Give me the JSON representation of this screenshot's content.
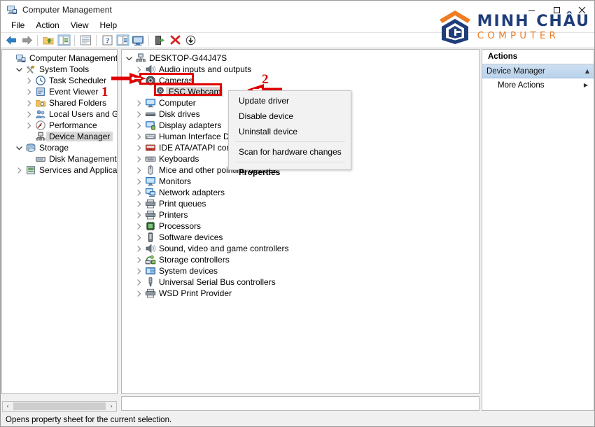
{
  "window": {
    "title": "Computer Management",
    "title_icon": "computer-management-icon",
    "minimize": "–",
    "maximize": "☐",
    "close": "✕"
  },
  "menubar": {
    "items": [
      {
        "label": "File",
        "name": "menu-file"
      },
      {
        "label": "Action",
        "name": "menu-action"
      },
      {
        "label": "View",
        "name": "menu-view"
      },
      {
        "label": "Help",
        "name": "menu-help"
      }
    ]
  },
  "toolbar": {
    "buttons": [
      {
        "icon": "back-arrow-icon",
        "title": "Back"
      },
      {
        "icon": "forward-arrow-icon",
        "title": "Forward"
      },
      {
        "icon": "up-folder-icon",
        "title": "Up One Level"
      },
      {
        "icon": "show-hide-console-tree-icon",
        "title": "Show/Hide Console Tree"
      },
      {
        "icon": "properties-icon",
        "title": "Properties"
      },
      {
        "icon": "help-icon",
        "title": "Help"
      },
      {
        "icon": "list-view-icon",
        "title": "View"
      },
      {
        "icon": "display-icon",
        "title": "Connect to another computer"
      },
      {
        "icon": "update-driver-icon",
        "title": "Update driver"
      },
      {
        "icon": "uninstall-device-icon",
        "title": "Uninstall device"
      },
      {
        "icon": "scan-hardware-icon",
        "title": "Scan for hardware changes"
      }
    ]
  },
  "console_tree": {
    "root": {
      "label": "Computer Management (Local",
      "icon": "computer-management-icon",
      "indent": 0,
      "twisty": "none",
      "selected": false
    },
    "items": [
      {
        "label": "System Tools",
        "icon": "system-tools-icon",
        "indent": 1,
        "twisty": "open",
        "selected": false
      },
      {
        "label": "Task Scheduler",
        "icon": "clock-icon",
        "indent": 2,
        "twisty": "closed",
        "selected": false
      },
      {
        "label": "Event Viewer",
        "icon": "event-viewer-icon",
        "indent": 2,
        "twisty": "closed",
        "selected": false
      },
      {
        "label": "Shared Folders",
        "icon": "shared-folders-icon",
        "indent": 2,
        "twisty": "closed",
        "selected": false
      },
      {
        "label": "Local Users and Groups",
        "icon": "users-icon",
        "indent": 2,
        "twisty": "closed",
        "selected": false
      },
      {
        "label": "Performance",
        "icon": "performance-icon",
        "indent": 2,
        "twisty": "closed",
        "selected": false
      },
      {
        "label": "Device Manager",
        "icon": "device-manager-icon",
        "indent": 2,
        "twisty": "none",
        "selected": true
      },
      {
        "label": "Storage",
        "icon": "storage-icon",
        "indent": 1,
        "twisty": "open",
        "selected": false
      },
      {
        "label": "Disk Management",
        "icon": "disk-management-icon",
        "indent": 2,
        "twisty": "none",
        "selected": false
      },
      {
        "label": "Services and Applications",
        "icon": "services-icon",
        "indent": 1,
        "twisty": "closed",
        "selected": false
      }
    ]
  },
  "device_tree": {
    "root": {
      "label": "DESKTOP-G44J47S",
      "icon": "computer-icon",
      "indent": 0,
      "twisty": "open"
    },
    "items": [
      {
        "label": "Audio inputs and outputs",
        "icon": "audio-icon",
        "indent": 1,
        "twisty": "closed"
      },
      {
        "label": "Cameras",
        "icon": "camera-icon",
        "indent": 1,
        "twisty": "open"
      },
      {
        "label": "FSC Webcam",
        "icon": "webcam-icon",
        "indent": 2,
        "twisty": "none",
        "selected": true
      },
      {
        "label": "Computer",
        "icon": "monitor-icon",
        "indent": 1,
        "twisty": "closed"
      },
      {
        "label": "Disk drives",
        "icon": "disk-drive-icon",
        "indent": 1,
        "twisty": "closed"
      },
      {
        "label": "Display adapters",
        "icon": "display-adapter-icon",
        "indent": 1,
        "twisty": "closed"
      },
      {
        "label": "Human Interface Devices",
        "icon": "hid-icon",
        "indent": 1,
        "twisty": "closed"
      },
      {
        "label": "IDE ATA/ATAPI controllers",
        "icon": "ide-icon",
        "indent": 1,
        "twisty": "closed"
      },
      {
        "label": "Keyboards",
        "icon": "keyboard-icon",
        "indent": 1,
        "twisty": "closed"
      },
      {
        "label": "Mice and other pointing devices",
        "icon": "mouse-icon",
        "indent": 1,
        "twisty": "closed"
      },
      {
        "label": "Monitors",
        "icon": "monitor-icon",
        "indent": 1,
        "twisty": "closed"
      },
      {
        "label": "Network adapters",
        "icon": "network-icon",
        "indent": 1,
        "twisty": "closed"
      },
      {
        "label": "Print queues",
        "icon": "printer-icon",
        "indent": 1,
        "twisty": "closed"
      },
      {
        "label": "Printers",
        "icon": "printer-icon",
        "indent": 1,
        "twisty": "closed"
      },
      {
        "label": "Processors",
        "icon": "processor-icon",
        "indent": 1,
        "twisty": "closed"
      },
      {
        "label": "Software devices",
        "icon": "software-device-icon",
        "indent": 1,
        "twisty": "closed"
      },
      {
        "label": "Sound, video and game controllers",
        "icon": "audio-icon",
        "indent": 1,
        "twisty": "closed"
      },
      {
        "label": "Storage controllers",
        "icon": "storage-controller-icon",
        "indent": 1,
        "twisty": "closed"
      },
      {
        "label": "System devices",
        "icon": "system-device-icon",
        "indent": 1,
        "twisty": "closed"
      },
      {
        "label": "Universal Serial Bus controllers",
        "icon": "usb-icon",
        "indent": 1,
        "twisty": "closed"
      },
      {
        "label": "WSD Print Provider",
        "icon": "printer-icon",
        "indent": 1,
        "twisty": "closed"
      }
    ]
  },
  "context_menu": {
    "items": [
      {
        "label": "Update driver",
        "bold": false,
        "separator_after": false
      },
      {
        "label": "Disable device",
        "bold": false,
        "separator_after": false
      },
      {
        "label": "Uninstall device",
        "bold": false,
        "separator_after": true
      },
      {
        "label": "Scan for hardware changes",
        "bold": false,
        "separator_after": true
      },
      {
        "label": "Properties",
        "bold": true,
        "separator_after": false
      }
    ]
  },
  "actions_pane": {
    "header": "Actions",
    "group_title": "Device Manager",
    "group_collapse_icon": "▲",
    "rows": [
      {
        "label": "More Actions",
        "chevron": "▶"
      }
    ]
  },
  "scrollbar": {
    "left_arrow": "‹",
    "right_arrow": "›"
  },
  "statusbar": {
    "text": "Opens property sheet for the current selection."
  },
  "logo": {
    "main": "MINH CHÂU",
    "sub": "COMPUTER",
    "mark": "minh-chau-hexagon-logo-icon",
    "color_blue": "#1f3d7a",
    "color_orange": "#ee7d23"
  },
  "annotations": {
    "step1": "1",
    "step2": "2",
    "highlight_color": "#e00000"
  }
}
